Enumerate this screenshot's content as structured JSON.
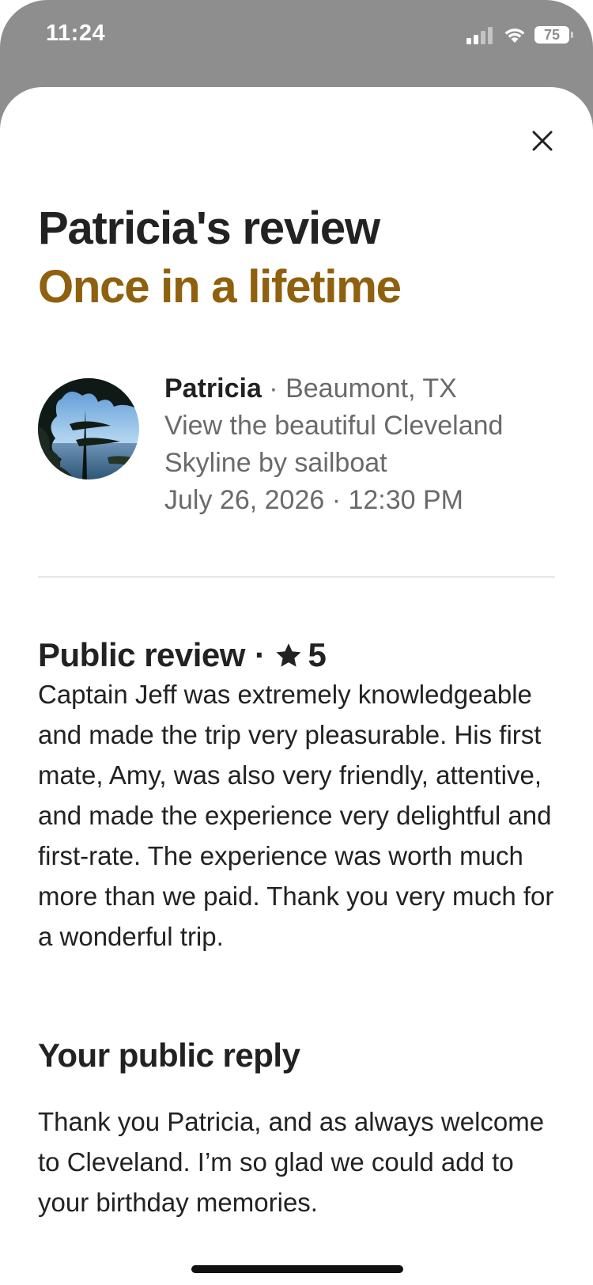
{
  "status_bar": {
    "time": "11:24",
    "battery": "75"
  },
  "review": {
    "title": "Patricia's review",
    "subtitle": "Once in a lifetime"
  },
  "guest": {
    "name": "Patricia",
    "separator": " · ",
    "location": "Beaumont, TX",
    "experience": "View the beautiful Cleveland Skyline by sailboat",
    "date_time": "July 26, 2026 · 12:30 PM"
  },
  "public_review": {
    "heading": "Public review",
    "separator": "·",
    "rating": "5",
    "text": "Captain Jeff was extremely knowledgeable and made the trip very pleasurable. His first mate, Amy, was also very friendly, attentive, and made the experience very delightful and first-rate. The experience was worth much more than we paid. Thank you very much for a wonderful trip."
  },
  "reply": {
    "heading": "Your public reply",
    "text": "Thank you Patricia, and as always welcome to Cleveland. I’m so glad we could add to your birthday memories."
  },
  "icons": {
    "close": "close-icon",
    "star": "star-icon",
    "signal": "signal-icon",
    "wifi": "wifi-icon",
    "battery": "battery-icon"
  },
  "colors": {
    "subtitle_gold": "#8f600d",
    "text_primary": "#222222",
    "text_secondary": "#6a6a6a",
    "backdrop": "#8e8e8e"
  }
}
